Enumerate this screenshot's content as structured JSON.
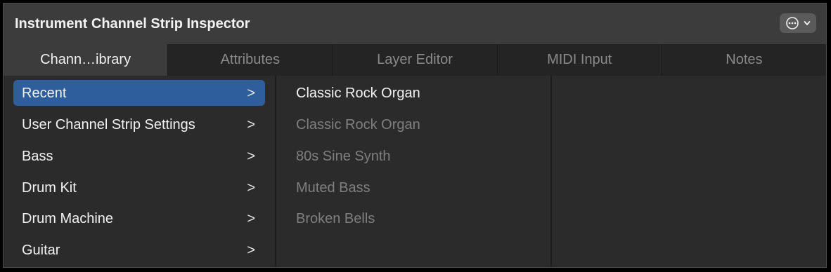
{
  "window": {
    "title": "Instrument Channel Strip Inspector",
    "menu_icon": "ellipsis-circle-icon"
  },
  "tabs": [
    {
      "label": "Chann…ibrary",
      "active": true
    },
    {
      "label": "Attributes",
      "active": false
    },
    {
      "label": "Layer Editor",
      "active": false
    },
    {
      "label": "MIDI Input",
      "active": false
    },
    {
      "label": "Notes",
      "active": false
    }
  ],
  "categories": [
    {
      "label": "Recent",
      "selected": true,
      "chevron": ">"
    },
    {
      "label": "User Channel Strip Settings",
      "selected": false,
      "chevron": ">"
    },
    {
      "label": "Bass",
      "selected": false,
      "chevron": ">"
    },
    {
      "label": "Drum Kit",
      "selected": false,
      "chevron": ">"
    },
    {
      "label": "Drum Machine",
      "selected": false,
      "chevron": ">"
    },
    {
      "label": "Guitar",
      "selected": false,
      "chevron": ">"
    }
  ],
  "recent_items": [
    {
      "label": "Classic Rock Organ",
      "current": true
    },
    {
      "label": "Classic Rock Organ",
      "current": false
    },
    {
      "label": "80s Sine Synth",
      "current": false
    },
    {
      "label": "Muted Bass",
      "current": false
    },
    {
      "label": "Broken Bells",
      "current": false
    }
  ],
  "colors": {
    "accent": "#2e5e9b",
    "background": "#2b2b2b",
    "titlebar": "#3c3c3c"
  }
}
